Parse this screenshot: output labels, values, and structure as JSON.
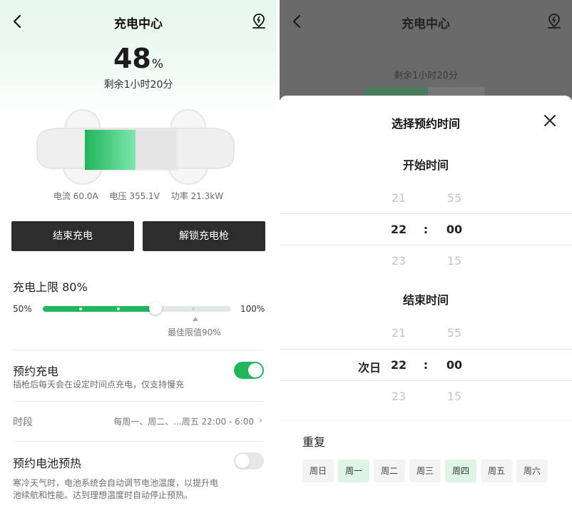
{
  "left": {
    "header": {
      "title": "充电中心",
      "back_icon": "chevron-left-icon",
      "map_icon": "location-charger-icon"
    },
    "battery": {
      "percent": "48",
      "unit": "%",
      "remaining": "剩余1小时20分",
      "fill_fraction": 0.48
    },
    "stats": {
      "current": "电流 60.0A",
      "voltage": "电压 355.1V",
      "power": "功率 21.3kW"
    },
    "buttons": {
      "stop": "结束充电",
      "unlock": "解锁充电枪"
    },
    "limit": {
      "title": "充电上限 80%",
      "min_label": "50%",
      "max_label": "100%",
      "best_label": "最佳限值90%",
      "value": 80,
      "min": 50,
      "max": 100,
      "best": 90
    },
    "schedule": {
      "title": "预约充电",
      "desc": "插枪后每天会在设定时间点充电，仅支持慢充",
      "enabled": true
    },
    "period": {
      "label": "时段",
      "value": "每周一、周二、...周五 22:00 - 6:00",
      "arrow": "›"
    },
    "preheat": {
      "title": "预约电池预热",
      "desc_line1": "寒冷天气时，电池系统会自动调节电池温度，以提升电",
      "desc_line2": "池续航和性能。达到理想温度时自动停止预热。",
      "enabled": false
    }
  },
  "right": {
    "header": {
      "title": "充电中心"
    },
    "background_remaining": "剩余1小时20分",
    "sheet": {
      "title": "选择预约时间",
      "start": {
        "title": "开始时间",
        "rows": [
          {
            "h": "21",
            "m": "55"
          },
          {
            "h": "22",
            "m": "00"
          },
          {
            "h": "23",
            "m": "15"
          }
        ],
        "colon": ":"
      },
      "end": {
        "title": "结束时间",
        "prefix": "次日",
        "rows": [
          {
            "h": "21",
            "m": "55"
          },
          {
            "h": "22",
            "m": "00"
          },
          {
            "h": "23",
            "m": "15"
          }
        ],
        "colon": ":"
      },
      "repeat": {
        "title": "重复",
        "days": [
          {
            "label": "周日",
            "selected": false
          },
          {
            "label": "周一",
            "selected": true
          },
          {
            "label": "周二",
            "selected": false
          },
          {
            "label": "周三",
            "selected": false
          },
          {
            "label": "周四",
            "selected": true
          },
          {
            "label": "周五",
            "selected": false
          },
          {
            "label": "周六",
            "selected": false
          }
        ]
      }
    }
  },
  "colors": {
    "accent": "#1fb75a",
    "button_dark": "#2d2d2d",
    "overlay": "#6a6a6a"
  }
}
